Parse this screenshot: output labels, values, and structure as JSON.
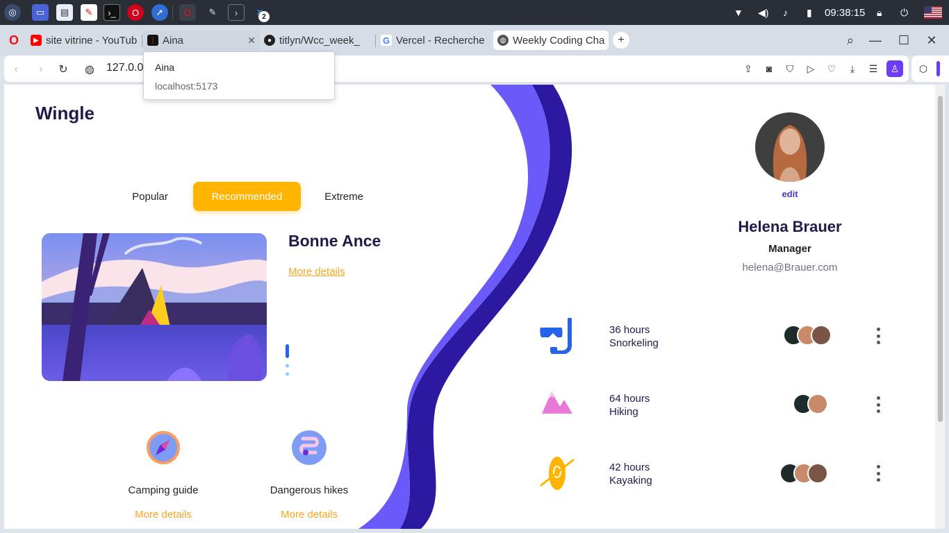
{
  "taskbar": {
    "clock": "09:38:15",
    "window_badge": "2"
  },
  "browser": {
    "tabs": [
      {
        "label": "site vitrine - YouTub",
        "favicon": "youtube-icon"
      },
      {
        "label": "Aina",
        "favicon": "aina-icon"
      },
      {
        "label": "titlyn/Wcc_week_",
        "favicon": "github-icon"
      },
      {
        "label": "Vercel - Recherche",
        "favicon": "google-icon"
      },
      {
        "label": "Weekly Coding Cha",
        "favicon": "globe-icon"
      }
    ],
    "address": "127.0.0.1",
    "tooltip": {
      "title": "Aina",
      "url": "localhost:5173"
    }
  },
  "app": {
    "brand": "Wingle",
    "filters": [
      "Popular",
      "Recommended",
      "Extreme"
    ],
    "active_filter": "Recommended",
    "featured": {
      "title": "Bonne Ance",
      "link": "More details"
    },
    "features": [
      {
        "title": "Camping guide",
        "link": "More details",
        "icon": "compass-icon"
      },
      {
        "title": "Dangerous hikes",
        "link": "More details",
        "icon": "winding-path-icon"
      }
    ],
    "profile": {
      "edit": "edit",
      "name": "Helena Brauer",
      "role": "Manager",
      "email": "helena@Brauer.com"
    },
    "activities": [
      {
        "hours": "36 hours",
        "name": "Snorkeling",
        "icon": "snorkel-icon"
      },
      {
        "hours": "64 hours",
        "name": "Hiking",
        "icon": "mountain-icon"
      },
      {
        "hours": "42 hours",
        "name": "Kayaking",
        "icon": "kayak-icon"
      }
    ]
  },
  "colors": {
    "accent": "#ffb400",
    "wave_light": "#6a5af9",
    "wave_dark": "#2b1aa0",
    "navy": "#1e1b4b"
  }
}
